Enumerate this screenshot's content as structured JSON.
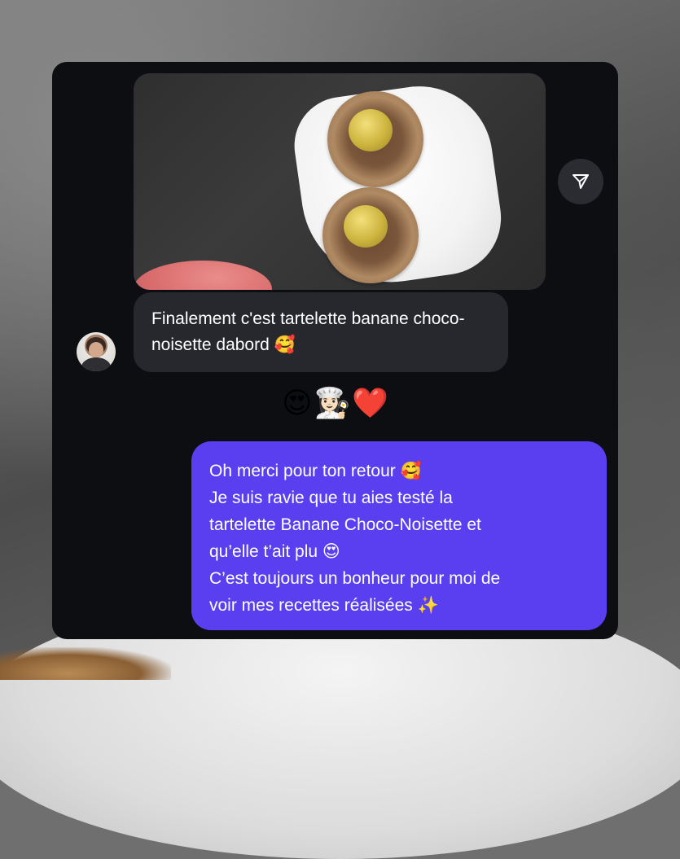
{
  "thread": {
    "incoming": {
      "text": "Finalement c'est tartelette banane choco-noisette dabord 🥰"
    },
    "reactions": [
      "😍",
      "👩🏻‍🍳",
      "❤️"
    ],
    "outgoing": {
      "lines": [
        "Oh merci pour ton retour 🥰",
        "Je suis ravie que tu aies testé la",
        "tartelette Banane Choco-Noisette et",
        "qu’elle t’ait plu 😍",
        "C’est toujours un bonheur pour moi de",
        "voir mes recettes réalisées ✨"
      ]
    }
  },
  "icons": {
    "share": "paper-plane-icon"
  },
  "colors": {
    "panel_bg": "#0d0e12",
    "incoming_bubble": "#26282d",
    "outgoing_bubble": "#5a3ff0",
    "share_button": "#2a2c31"
  }
}
